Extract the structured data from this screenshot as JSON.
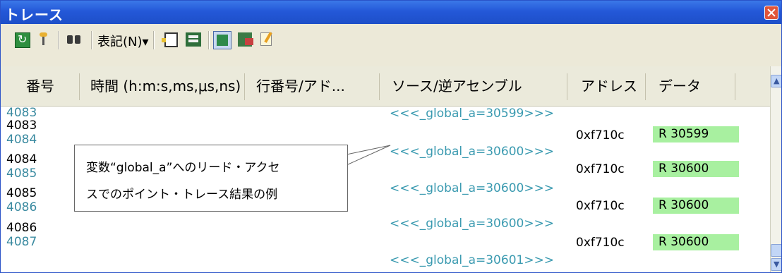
{
  "window": {
    "title": "トレース"
  },
  "toolbar": {
    "view_menu": "表記(N)▾"
  },
  "columns": [
    "番号",
    "時間 (h:m:s,ms,μs,ns)",
    "行番号/アド...",
    "ソース/逆アセンブル",
    "アドレス",
    "データ"
  ],
  "rows": [
    {
      "num": "4083",
      "kind": "source",
      "source": "<<<_global_a=30599>>>"
    },
    {
      "num": "4083",
      "kind": "data",
      "address": "0xf710c",
      "data": "R 30599"
    },
    {
      "num": "4084",
      "kind": "source",
      "source": "<<<_global_a=30600>>>"
    },
    {
      "num": "4084",
      "kind": "data",
      "address": "0xf710c",
      "data": "R 30600"
    },
    {
      "num": "4085",
      "kind": "source",
      "source": "<<<_global_a=30600>>>"
    },
    {
      "num": "4085",
      "kind": "data",
      "address": "0xf710c",
      "data": "R 30600"
    },
    {
      "num": "4086",
      "kind": "source",
      "source": "<<<_global_a=30600>>>"
    },
    {
      "num": "4086",
      "kind": "data",
      "address": "0xf710c",
      "data": "R 30600"
    },
    {
      "num": "4087",
      "kind": "source",
      "source": "<<<_global_a=30601>>>"
    }
  ],
  "callout": {
    "line1": "変数“global_a”へのリード・アクセ",
    "line2": "スでのポイント・トレース結果の例"
  },
  "colors": {
    "titlebar": "#2458d8",
    "source_text": "#3a9ab0",
    "data_fill": "#a8f0a0"
  }
}
